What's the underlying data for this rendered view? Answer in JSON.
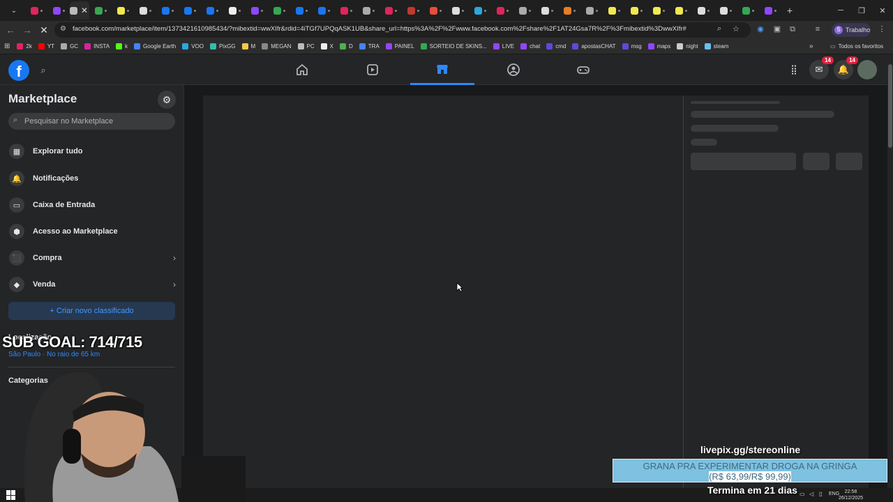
{
  "browser": {
    "url": "facebook.com/marketplace/item/1373421610985434/?mibextid=wwXIfr&rdid=4iTGf7UPQqASK1UB&share_url=https%3A%2F%2Fwww.facebook.com%2Fshare%2F1AT24Gsa7R%2F%3Fmibextid%3DwwXIfr#",
    "profile_label": "Trabalho",
    "profile_initial": "S",
    "bookmarks": [
      {
        "label": "2k",
        "color": "#e0245e"
      },
      {
        "label": "YT",
        "color": "#ff0000"
      },
      {
        "label": "GC",
        "color": "#aaaaaa"
      },
      {
        "label": "INSTA",
        "color": "#d6249f"
      },
      {
        "label": "k",
        "color": "#53fc18"
      },
      {
        "label": "Google Earth",
        "color": "#4285f4"
      },
      {
        "label": "VOO",
        "color": "#2ca8e0"
      },
      {
        "label": "PixGG",
        "color": "#32bcad"
      },
      {
        "label": "M",
        "color": "#f2c94c"
      },
      {
        "label": "MEGAN",
        "color": "#888888"
      },
      {
        "label": "PC",
        "color": "#bbbbbb"
      },
      {
        "label": "X",
        "color": "#eeeeee"
      },
      {
        "label": "D",
        "color": "#4caf50"
      },
      {
        "label": "TRA",
        "color": "#4285f4"
      },
      {
        "label": "PAINEL",
        "color": "#9146ff"
      },
      {
        "label": "SORTEIO DE SKINS...",
        "color": "#34a853"
      },
      {
        "label": "LIVE",
        "color": "#9146ff"
      },
      {
        "label": "chat",
        "color": "#9146ff"
      },
      {
        "label": "cmd",
        "color": "#5b4bd8"
      },
      {
        "label": "apostasCHAT",
        "color": "#5b4bd8"
      },
      {
        "label": "msg",
        "color": "#5b4bd8"
      },
      {
        "label": "maps",
        "color": "#9146ff"
      },
      {
        "label": "night",
        "color": "#cccccc"
      },
      {
        "label": "steam",
        "color": "#66c0f4"
      }
    ],
    "bookmarks_all": "Todos os favoritos",
    "tabs": [
      {
        "color": "#e0245e"
      },
      {
        "color": "#9146ff"
      },
      {
        "color": "#bbbbbb"
      },
      {
        "color": "#34a853"
      },
      {
        "color": "#f2e94e"
      },
      {
        "color": "#dddddd"
      },
      {
        "color": "#1877f2"
      },
      {
        "color": "#1877f2"
      },
      {
        "color": "#1877f2"
      },
      {
        "color": "#eeeeee"
      },
      {
        "color": "#9146ff"
      },
      {
        "color": "#34a853"
      },
      {
        "color": "#1877f2"
      },
      {
        "color": "#1877f2"
      },
      {
        "color": "#e0245e"
      },
      {
        "color": "#aaaaaa"
      },
      {
        "color": "#e0245e"
      },
      {
        "color": "#c0392b"
      },
      {
        "color": "#e74c3c"
      },
      {
        "color": "#dddddd"
      },
      {
        "color": "#2ca8e0"
      },
      {
        "color": "#e0245e"
      },
      {
        "color": "#aaaaaa"
      },
      {
        "color": "#dddddd"
      },
      {
        "color": "#e67e22"
      },
      {
        "color": "#aaaaaa"
      },
      {
        "color": "#f2e94e"
      },
      {
        "color": "#f2e94e"
      },
      {
        "color": "#f2e94e"
      },
      {
        "color": "#f2e94e"
      },
      {
        "color": "#dddddd"
      },
      {
        "color": "#dddddd"
      },
      {
        "color": "#34a853"
      },
      {
        "color": "#9146ff"
      }
    ]
  },
  "facebook": {
    "logo": "f",
    "messenger_badge": "14",
    "notifications_badge": "14"
  },
  "sidebar": {
    "title": "Marketplace",
    "search_placeholder": "Pesquisar no Marketplace",
    "items": [
      {
        "label": "Explorar tudo",
        "icon": "storefront-icon",
        "glyph": "▦"
      },
      {
        "label": "Notificações",
        "icon": "bell-icon",
        "glyph": "🔔"
      },
      {
        "label": "Caixa de Entrada",
        "icon": "inbox-icon",
        "glyph": "▭"
      },
      {
        "label": "Acesso ao Marketplace",
        "icon": "shield-icon",
        "glyph": "⬢"
      },
      {
        "label": "Compra",
        "icon": "shopping-bag-icon",
        "glyph": "⬛",
        "has_chevron": true
      },
      {
        "label": "Venda",
        "icon": "tag-icon",
        "glyph": "◆",
        "has_chevron": true
      }
    ],
    "create_button": "+ Criar novo classificado",
    "location_heading": "Localização",
    "location_value": "São Paulo · No raio de 65 km",
    "categories_heading": "Categorias"
  },
  "overlay": {
    "sub_goal": "SUB GOAL: 714/715",
    "livepix": "livepix.gg/stereonline",
    "donation_line1": "GRANA PRA EXPERIMENTAR DROGA NA GRINGA",
    "donation_amount": "(R$ 63,99/R$ 99,99)",
    "countdown": "Termina em 21 dias"
  },
  "taskbar": {
    "lang": "ENG",
    "time": "22:58",
    "date": "26/12/2025"
  },
  "colors": {
    "fb_blue": "#1877f2",
    "accent": "#2d88ff",
    "badge": "#e41e3f"
  }
}
